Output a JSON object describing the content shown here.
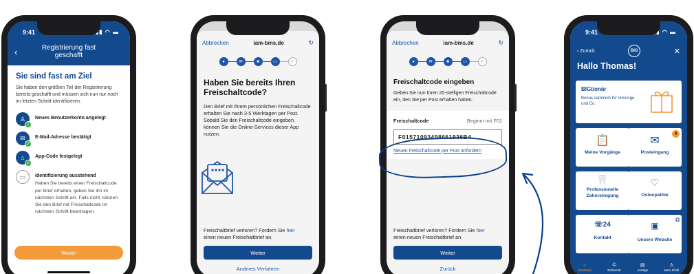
{
  "screen1": {
    "status_time": "9:41",
    "title": "Registrierung fast geschafft",
    "heading": "Sie sind fast am Ziel",
    "intro": "Sie haben den größten Teil der Registrierung bereits geschafft und müssen sich nun nur noch im letzten Schritt identifizieren.",
    "steps": [
      {
        "label": "Neues Benutzerkonto angelegt"
      },
      {
        "label": "E-Mail-Adresse bestätigt"
      },
      {
        "label": "App-Code festgelegt"
      },
      {
        "label": "Identifizierung ausstehend",
        "desc": "Haben Sie bereits einen Freischaltcode per Brief erhalten, geben Sie ihn im nächsten Schritt ein. Falls nicht, können Sie den Brief mit Freischaltcode im nächsten Schritt beantragen."
      }
    ],
    "button": "Weiter"
  },
  "screen2": {
    "cancel": "Abbrechen",
    "domain": "iam-bms.de",
    "title": "Haben Sie bereits Ihren Freischaltcode?",
    "text": "Den Brief mit Ihrem persönlichen Freischaltcode erhalten Sie nach 3-5 Werktagen per Post. Sobald Sie den Freischaltcode eingeben, können Sie die Online-Services dieser App nutzen.",
    "lost_text": "Freischaltbrief verloren? Fordern Sie",
    "lost_link": "hier",
    "lost_text2": "einen neuen Freischaltbrief an.",
    "button": "Weiter",
    "secondary": "Anderes Verfahren"
  },
  "screen3": {
    "cancel": "Abbrechen",
    "domain": "iam-bms.de",
    "title": "Freischaltcode eingeben",
    "text": "Geben Sie nun Ihren 20-stelligen Freischaltcode ein, den Sie per Post erhalten haben.",
    "code_label": "Freischaltcode",
    "code_hint": "Beginnt mit F01",
    "code_value": "F01571093498661936B4",
    "code_link": "Neuen Freischaltcode per Post anfordern",
    "lost_text": "Freischaltbrief verloren? Fordern Sie",
    "lost_link": "hier",
    "lost_text2": "einen neuen Freischaltbrief an.",
    "button": "Weiter",
    "secondary": "Zurück"
  },
  "screen4": {
    "status_time": "9:41",
    "back": "Zurück",
    "logo": "BIG",
    "greeting": "Hallo Thomas!",
    "bigtionaer_title": "BIGtionär",
    "bigtionaer_sub": "Bonus sammeln für Vorsorge und Co.",
    "tiles": [
      {
        "label": "Meine Vorgänge"
      },
      {
        "label": "Posteingang",
        "badge": "9"
      },
      {
        "label": "Professionelle Zahnreinigung"
      },
      {
        "label": "Osteopathie"
      },
      {
        "label": "Kontakt"
      },
      {
        "label": "Unsere Website"
      }
    ],
    "tabs": [
      {
        "label": "Startseite",
        "icon": "home-icon"
      },
      {
        "label": "BIGtionär",
        "icon": "bonus-icon"
      },
      {
        "label": "Anträge",
        "icon": "document-icon"
      },
      {
        "label": "Mein Profil",
        "icon": "profile-icon"
      }
    ]
  },
  "colors": {
    "brand_blue": "#134a8e",
    "accent_orange": "#f39a3a",
    "link_blue": "#1f55a8",
    "success_green": "#3aae49"
  }
}
